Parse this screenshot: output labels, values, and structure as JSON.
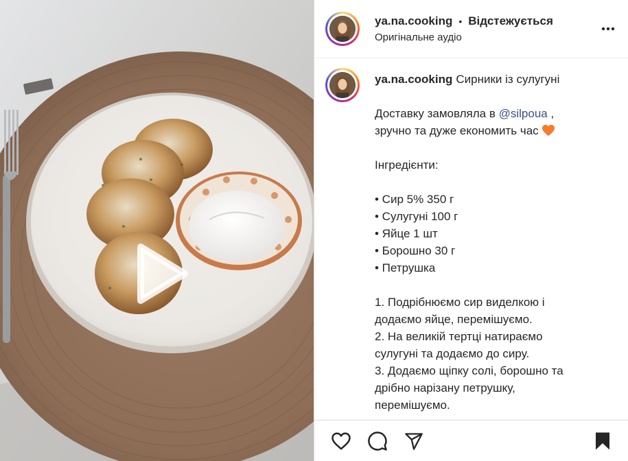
{
  "header": {
    "username": "ya.na.cooking",
    "separator": "•",
    "follow_status": "Відстежується",
    "audio_label": "Оригінальне аудіо",
    "more_icon": "more-horizontal-icon"
  },
  "caption": {
    "username": "ya.na.cooking",
    "title": "Сирники із сулугуні",
    "delivery_prefix": "Доставку замовляла в ",
    "mention": "@silpoua",
    "delivery_suffix": " ,",
    "delivery_line2": "зручно та дуже економить час ",
    "heart_color": "#f77b2b",
    "ingredients_heading": "Інгредієнти:",
    "ingredients": [
      "• Сир 5% 350 г",
      "• Сулугуні 100 г",
      "• Яйце 1 шт",
      "• Борошно 30 г",
      "• Петрушка"
    ],
    "steps": [
      "1. Подрібнюємо сир виделкою і",
      "додаємо яйце, перемішуємо.",
      "2. На великій тертці натираємо",
      "сулугуні та додаємо до сиру.",
      "3. Додаємо щіпку солі, борошно та",
      "дрібно нарізану петрушку,",
      "перемішуємо."
    ]
  },
  "actions": {
    "like_icon": "heart-icon",
    "comment_icon": "comment-icon",
    "share_icon": "share-icon",
    "save_icon": "bookmark-icon"
  },
  "media": {
    "play_icon": "play-icon"
  }
}
